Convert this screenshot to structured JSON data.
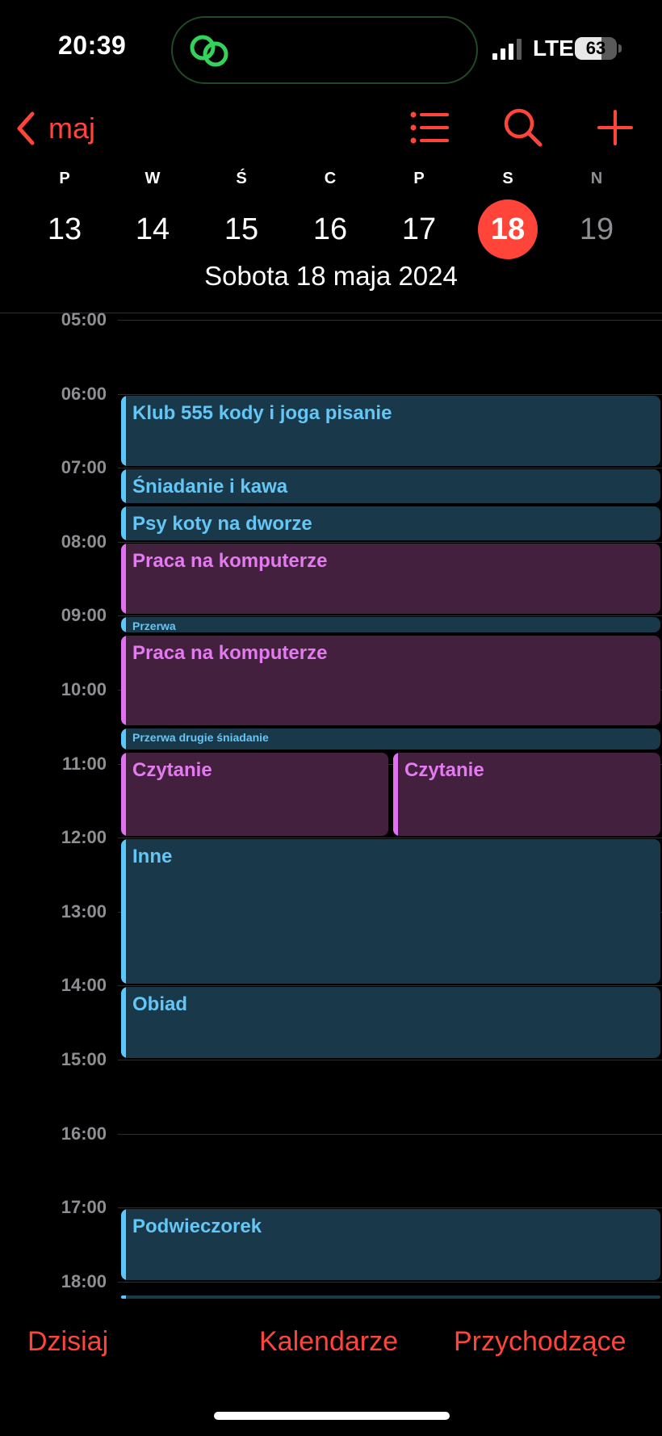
{
  "status_bar": {
    "time": "20:39",
    "network": "LTE",
    "battery": "63",
    "battery_level": 0.63,
    "activity_icon": "link-icon"
  },
  "nav": {
    "back_label": "maj",
    "icons": [
      "chevron-left-icon",
      "list-icon",
      "search-icon",
      "plus-icon"
    ]
  },
  "week": {
    "days": [
      {
        "letter": "P",
        "number": "13"
      },
      {
        "letter": "W",
        "number": "14"
      },
      {
        "letter": "Ś",
        "number": "15"
      },
      {
        "letter": "C",
        "number": "16"
      },
      {
        "letter": "P",
        "number": "17"
      },
      {
        "letter": "S",
        "number": "18",
        "selected": true
      },
      {
        "letter": "N",
        "number": "19"
      }
    ],
    "selected_date": "Sobota  18 maja 2024"
  },
  "timeline": {
    "hours": [
      "05:00",
      "06:00",
      "07:00",
      "08:00",
      "09:00",
      "10:00",
      "11:00",
      "12:00",
      "13:00",
      "14:00",
      "15:00",
      "16:00",
      "17:00",
      "18:00"
    ],
    "events": [
      {
        "title": "Klub 555 kody i joga pisanie",
        "start": "06:00",
        "end": "07:00",
        "color": "blue"
      },
      {
        "title": "Śniadanie i kawa",
        "start": "07:00",
        "end": "07:30",
        "color": "blue"
      },
      {
        "title": "Psy koty na dworze",
        "start": "07:30",
        "end": "08:00",
        "color": "blue"
      },
      {
        "title": "Praca na komputerze",
        "start": "08:00",
        "end": "09:00",
        "color": "purple"
      },
      {
        "title": "Przerwa",
        "start": "09:00",
        "end": "09:15",
        "color": "blue"
      },
      {
        "title": "Praca na komputerze",
        "start": "09:15",
        "end": "10:30",
        "color": "purple"
      },
      {
        "title": "Przerwa drugie śniadanie",
        "start": "10:30",
        "end": "10:50",
        "color": "blue"
      },
      {
        "title": "Czytanie",
        "start": "10:50",
        "end": "12:00",
        "color": "purple",
        "column": 0
      },
      {
        "title": "Czytanie",
        "start": "10:50",
        "end": "12:00",
        "color": "purple",
        "column": 1
      },
      {
        "title": "Inne",
        "start": "12:00",
        "end": "14:00",
        "color": "blue"
      },
      {
        "title": "Obiad",
        "start": "14:00",
        "end": "15:00",
        "color": "blue"
      },
      {
        "title": "Podwieczorek",
        "start": "17:00",
        "end": "18:00",
        "color": "blue"
      },
      {
        "title": "",
        "start": "18:10",
        "end": "18:40",
        "color": "blue"
      }
    ]
  },
  "toolbar": {
    "today": "Dzisiaj",
    "calendars": "Kalendarze",
    "inbox": "Przychodzące"
  },
  "colors": {
    "accent": "#ff453a",
    "event_blue_bg": "#193849",
    "event_blue_text": "#64c6f5",
    "event_purple_bg": "#44203f",
    "event_purple_text": "#e37af0"
  }
}
